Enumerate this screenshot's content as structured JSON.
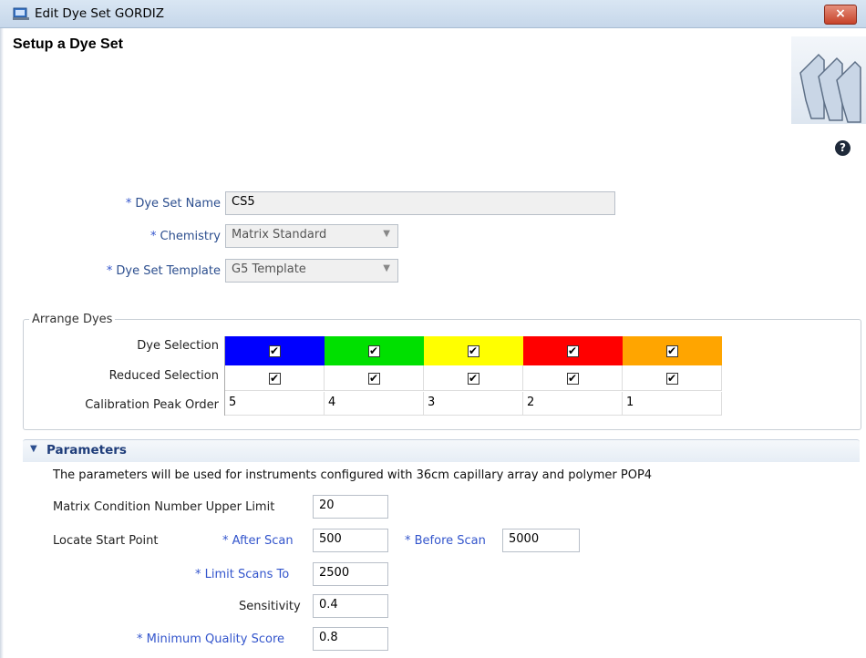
{
  "window": {
    "title": "Edit Dye Set GORDIZ",
    "close_label": "×"
  },
  "header": {
    "title": "Setup a Dye Set",
    "help_label": "?"
  },
  "form": {
    "dye_set_name": {
      "label": "Dye Set Name",
      "value": "CS5"
    },
    "chemistry": {
      "label": "Chemistry",
      "value": "Matrix Standard"
    },
    "template": {
      "label": "Dye Set Template",
      "value": "G5 Template"
    },
    "required_mark": "*"
  },
  "arrange": {
    "legend": "Arrange Dyes",
    "row_dye_selection": "Dye Selection",
    "row_reduced_selection": "Reduced Selection",
    "row_calibration": "Calibration Peak Order",
    "dyes": [
      {
        "color": "#0000ff",
        "order": "5"
      },
      {
        "color": "#00e000",
        "order": "4"
      },
      {
        "color": "#ffff00",
        "order": "3"
      },
      {
        "color": "#ff0000",
        "order": "2"
      },
      {
        "color": "#ffa500",
        "order": "1"
      }
    ],
    "check_mark": "✔"
  },
  "parameters": {
    "title": "Parameters",
    "description": "The parameters will be used for instruments configured with 36cm capillary array and polymer POP4",
    "matrix_condition": {
      "label": "Matrix Condition Number Upper Limit",
      "value": "20"
    },
    "locate_start": {
      "label": "Locate Start Point"
    },
    "after_scan": {
      "label": "After Scan",
      "value": "500"
    },
    "before_scan": {
      "label": "Before Scan",
      "value": "5000"
    },
    "limit_scans": {
      "label": "Limit Scans To",
      "value": "2500"
    },
    "sensitivity": {
      "label": "Sensitivity",
      "value": "0.4"
    },
    "min_quality": {
      "label": "Minimum Quality Score",
      "value": "0.8"
    }
  }
}
